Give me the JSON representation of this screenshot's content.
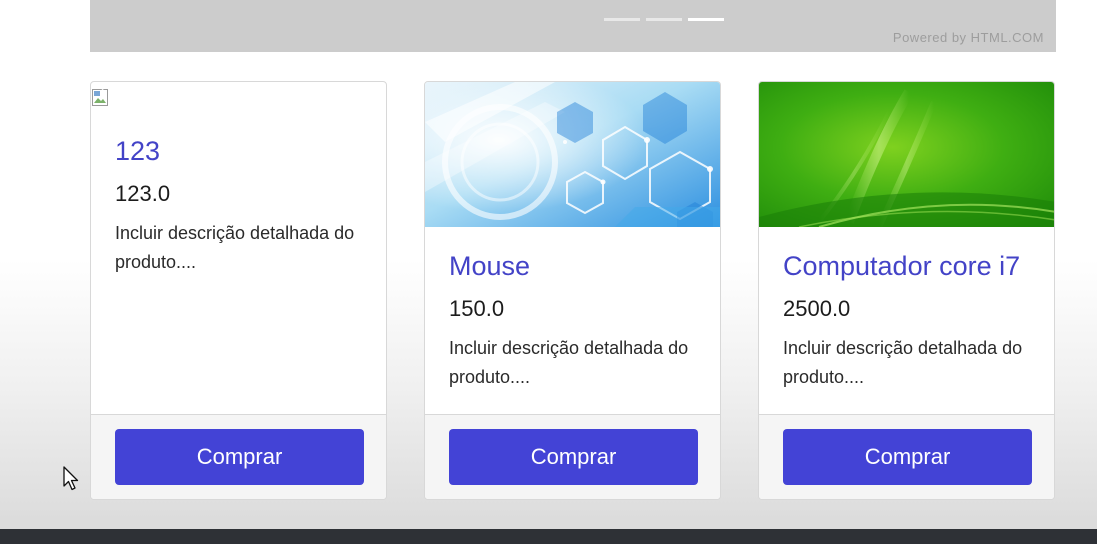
{
  "carousel": {
    "powered_by": "Powered by HTML.COM",
    "indicators": 3,
    "active_indicator": 3
  },
  "products": [
    {
      "title": "123",
      "price": "123.0",
      "description": "Incluir descrição detalhada do produto....",
      "button": "Comprar",
      "image": "broken-image"
    },
    {
      "title": "Mouse",
      "price": "150.0",
      "description": "Incluir descrição detalhada do produto....",
      "button": "Comprar",
      "image": "blue-hexagon-tech-image"
    },
    {
      "title": "Computador core i7",
      "price": "2500.0",
      "description": "Incluir descrição detalhada do produto....",
      "button": "Comprar",
      "image": "green-abstract-image"
    }
  ],
  "colors": {
    "accent": "#4343d6",
    "title": "#4343c7",
    "carousel_bg": "#cccccc",
    "bottom_bar": "#2e3136"
  }
}
